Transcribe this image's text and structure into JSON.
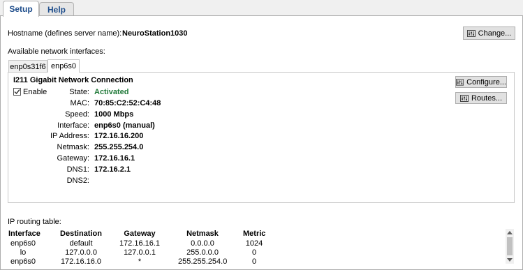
{
  "tabs": [
    {
      "label": "Setup",
      "active": true
    },
    {
      "label": "Help",
      "active": false
    }
  ],
  "hostname": {
    "label": "Hostname (defines server name):",
    "value": "NeuroStation1030",
    "change_button": "Change..."
  },
  "interfaces_label": "Available network interfaces:",
  "interface_tabs": [
    {
      "label": "enp0s31f6",
      "active": false
    },
    {
      "label": "enp6s0",
      "active": true
    }
  ],
  "interface": {
    "title": "I211 Gigabit Network Connection",
    "enable_label": "Enable",
    "enabled": true,
    "configure_button": "Configure...",
    "routes_button": "Routes...",
    "fields": [
      {
        "label": "State:",
        "value": "Activated"
      },
      {
        "label": "MAC:",
        "value": "70:85:C2:52:C4:48"
      },
      {
        "label": "Speed:",
        "value": "1000 Mbps"
      },
      {
        "label": "Interface:",
        "value": "enp6s0 (manual)"
      },
      {
        "label": "IP Address:",
        "value": "172.16.16.200"
      },
      {
        "label": "Netmask:",
        "value": "255.255.254.0"
      },
      {
        "label": "Gateway:",
        "value": "172.16.16.1"
      },
      {
        "label": "DNS1:",
        "value": "172.16.2.1"
      },
      {
        "label": "DNS2:",
        "value": ""
      }
    ]
  },
  "routing": {
    "label": "IP routing table:",
    "columns": [
      "Interface",
      "Destination",
      "Gateway",
      "Netmask",
      "Metric"
    ],
    "rows": [
      [
        "enp6s0",
        "default",
        "172.16.16.1",
        "0.0.0.0",
        "1024"
      ],
      [
        "lo",
        "127.0.0.0",
        "127.0.0.1",
        "255.0.0.0",
        "0"
      ],
      [
        "enp6s0",
        "172.16.16.0",
        "*",
        "255.255.254.0",
        "0"
      ]
    ]
  },
  "colors": {
    "state_active": "#217a3a",
    "tab_text": "#1f4e8c"
  },
  "icons": {
    "settings_button_icon": "sliders-icon",
    "enable_check_icon": "checkmark-icon"
  }
}
